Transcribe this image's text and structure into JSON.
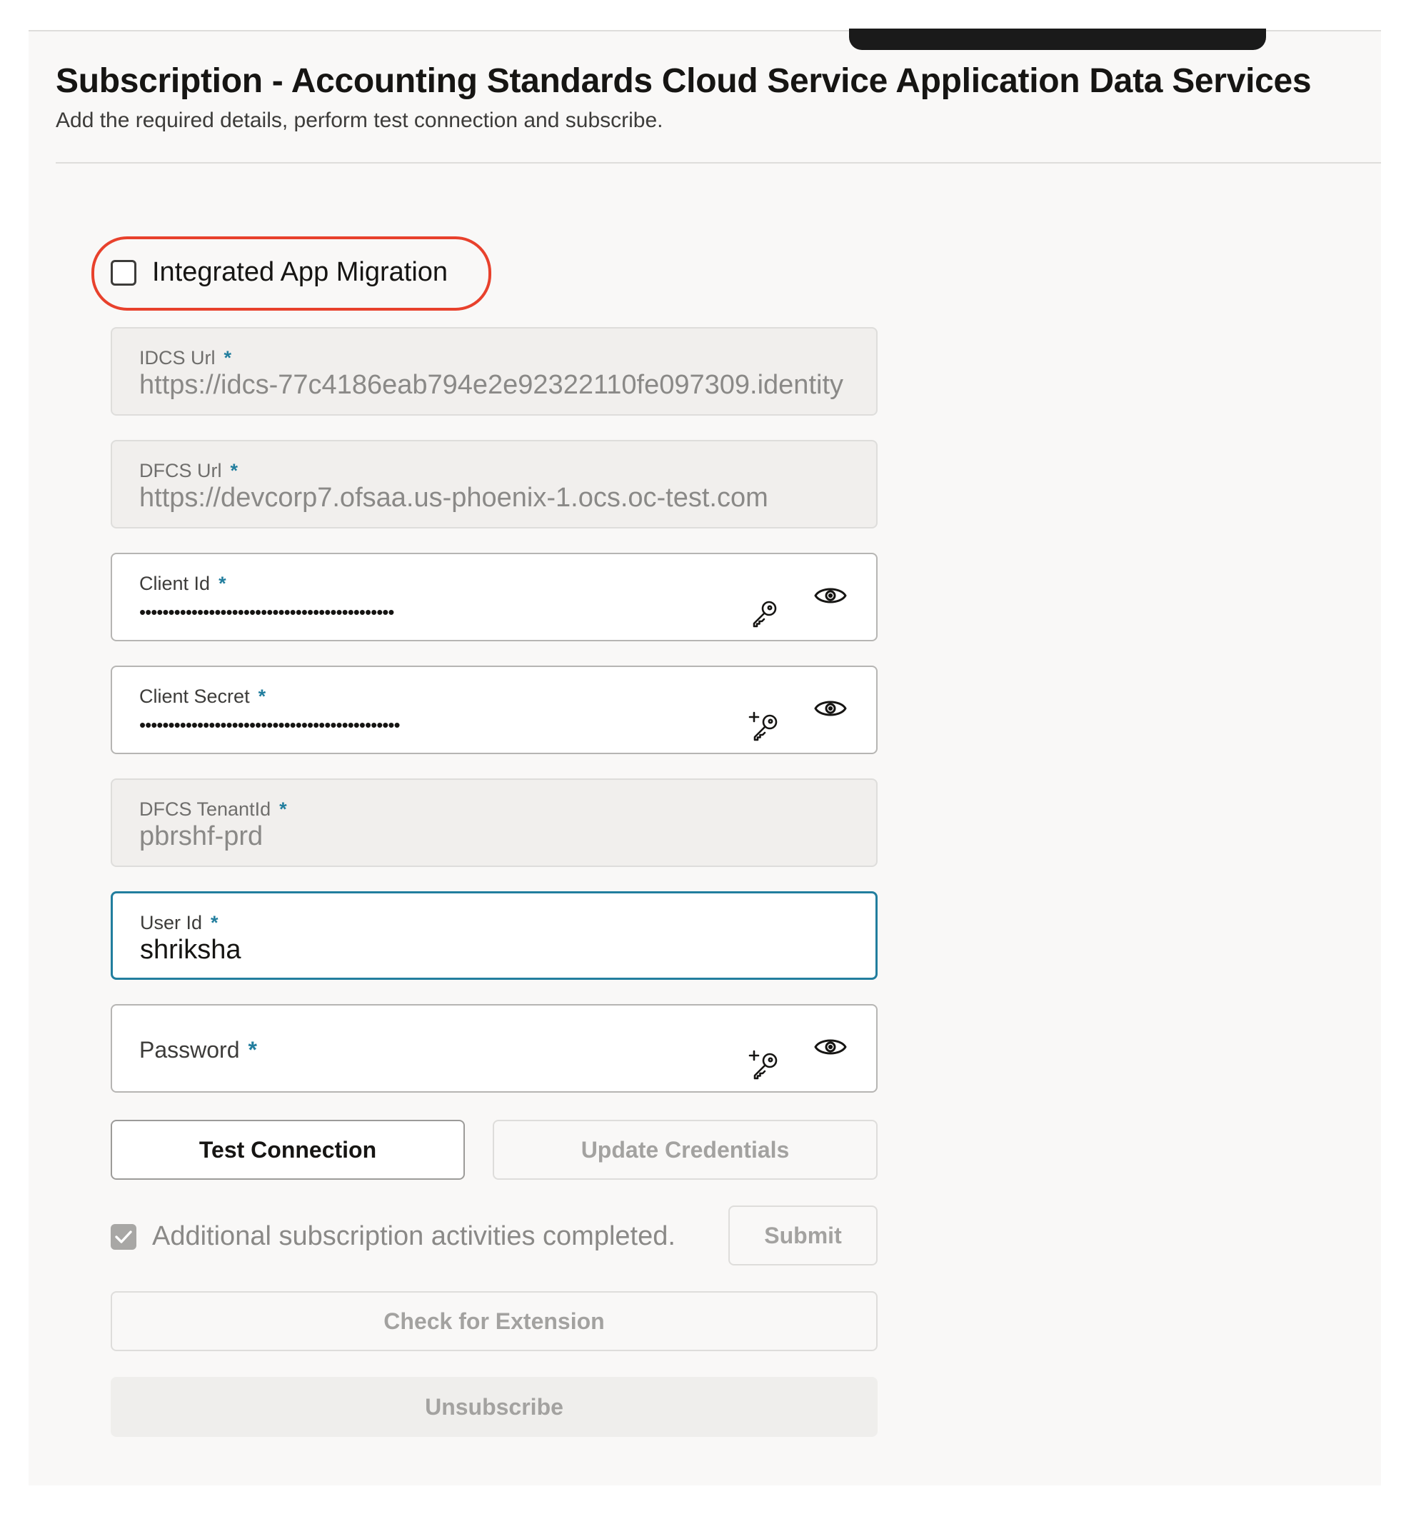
{
  "header": {
    "title": "Subscription - Accounting Standards Cloud Service Application Data Services",
    "subtitle": "Add the required details, perform test connection and subscribe."
  },
  "integrated_app_migration": {
    "label": "Integrated App Migration",
    "checked": false
  },
  "fields": {
    "idcs_url": {
      "label": "IDCS Url",
      "value": "https://idcs-77c4186eab794e2e92322110fe097309.identity"
    },
    "dfcs_url": {
      "label": "DFCS Url",
      "value": "https://devcorp7.ofsaa.us-phoenix-1.ocs.oc-test.com"
    },
    "client_id": {
      "label": "Client Id",
      "value": "••••••••••••••••••••••••••••••••••••••••••••"
    },
    "client_secret": {
      "label": "Client Secret",
      "value": "•••••••••••••••••••••••••••••••••••••••••••••"
    },
    "dfcs_tenant_id": {
      "label": "DFCS TenantId",
      "value": "pbrshf-prd"
    },
    "user_id": {
      "label": "User Id",
      "value": "shriksha"
    },
    "password": {
      "label": "Password",
      "value": ""
    },
    "required_marker": "*"
  },
  "buttons": {
    "test_connection": "Test Connection",
    "update_credentials": "Update Credentials",
    "submit": "Submit",
    "check_for_extension": "Check for Extension",
    "unsubscribe": "Unsubscribe"
  },
  "additional_activities": {
    "label": "Additional subscription activities completed.",
    "checked": true
  },
  "icons": {
    "key": "key-icon",
    "add_key": "add-key-icon",
    "show_password": "eye-icon",
    "checkmark": "checkmark-icon"
  },
  "colors": {
    "accent": "#227e9e",
    "highlight": "#e8412c",
    "required": "#227e9e"
  }
}
